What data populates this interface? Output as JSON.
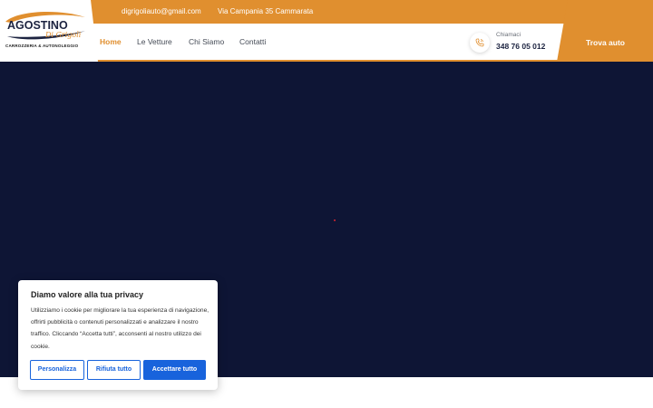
{
  "colors": {
    "accent": "#e08f2f",
    "hero_background": "#0e1535",
    "cookie_button": "#1863dc"
  },
  "topbar": {
    "email": "digrigoliauto@gmail.com",
    "address": "Via Campania 35 Cammarata",
    "social": [
      "facebook-icon",
      "instagram-icon"
    ]
  },
  "logo": {
    "name": "AGOSTINO",
    "script": "Di Grigoli",
    "subtitle": "CARROZZERIA & AUTONOLEGGIO"
  },
  "nav": {
    "items": [
      {
        "label": "Home",
        "active": true
      },
      {
        "label": "Le Vetture"
      },
      {
        "label": "Chi Siamo"
      },
      {
        "label": "Contatti"
      }
    ]
  },
  "contact": {
    "label": "Chiamaci",
    "phone": "348 76 05 012",
    "icon": "phone-icon"
  },
  "cta": {
    "label": "Trova auto"
  },
  "cookie": {
    "title": "Diamo valore alla tua privacy",
    "text": "Utilizziamo i cookie per migliorare la tua esperienza di navigazione, offrirti pubblicità o contenuti personalizzati e analizzare il nostro traffico. Cliccando “Accetta tutti”, acconsenti al nostro utilizzo dei cookie.",
    "buttons": {
      "customize": "Personalizza",
      "reject": "Rifiuta tutto",
      "accept": "Accettare tutto"
    }
  }
}
